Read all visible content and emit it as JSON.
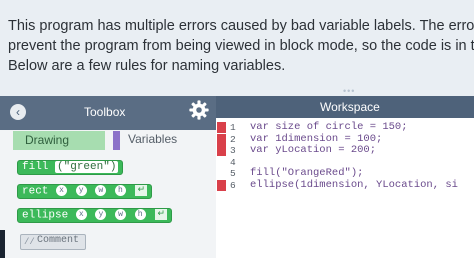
{
  "intro": {
    "line1": "This program has multiple errors caused by bad variable labels. The errors",
    "line2": "prevent the program from being viewed in block mode, so the code is in text",
    "line3": "Below are a few rules for naming variables."
  },
  "toolbox": {
    "title": "Toolbox",
    "back_icon": "chevron-left-icon",
    "settings_icon": "gear-icon",
    "tabs": {
      "drawing": "Drawing",
      "variables": "Variables"
    },
    "blocks": {
      "fill": {
        "name": "fill",
        "arg": "(\"green\")"
      },
      "rect": {
        "name": "rect",
        "params": [
          "x",
          "y",
          "w",
          "h"
        ]
      },
      "ellipse": {
        "name": "ellipse",
        "params": [
          "x",
          "y",
          "w",
          "h"
        ]
      },
      "comment": "Comment"
    }
  },
  "workspace": {
    "title": "Workspace",
    "lines": [
      {
        "num": "1",
        "text": "var size of circle = 150;",
        "error": true
      },
      {
        "num": "2",
        "text": "var 1dimension = 100;",
        "error": true
      },
      {
        "num": "3",
        "text": "var yLocation = 200;",
        "error": true
      },
      {
        "num": "4",
        "text": "",
        "error": false
      },
      {
        "num": "5",
        "text": "fill(\"OrangeRed\");",
        "error": false
      },
      {
        "num": "6",
        "text": "ellipse(1dimension, YLocation, si",
        "error": true
      }
    ]
  },
  "colors": {
    "toolbox_header": "#5a6d84",
    "workspace_header": "#4e627a",
    "block_green": "#3cb95a",
    "error_marker": "#d9404a",
    "drawing_tab": "#a7ddb0",
    "variables_tab_accent": "#8c72c9"
  }
}
